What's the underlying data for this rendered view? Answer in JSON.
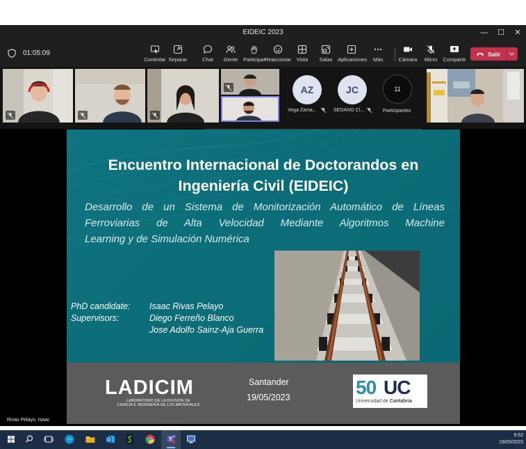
{
  "window": {
    "title": "EIDEIC 2023",
    "controls": {
      "minimize": "—",
      "maximize": "☐",
      "close": "✕"
    }
  },
  "toolbar": {
    "elapsed": "01:05:09",
    "buttons": [
      {
        "name": "controlar",
        "label": "Controlar",
        "icon": "control-icon"
      },
      {
        "name": "separar",
        "label": "Separar",
        "icon": "popout-icon"
      },
      {
        "name": "chat",
        "label": "Chat",
        "icon": "chat-icon"
      },
      {
        "name": "gente",
        "label": "Gente",
        "icon": "people-icon"
      },
      {
        "name": "participar",
        "label": "Participar",
        "icon": "raise-hand-icon"
      },
      {
        "name": "reaccionar",
        "label": "Reaccionar",
        "icon": "emoji-icon"
      },
      {
        "name": "vista",
        "label": "Vista",
        "icon": "grid-view-icon"
      },
      {
        "name": "salas",
        "label": "Salas",
        "icon": "rooms-icon"
      },
      {
        "name": "aplicaciones",
        "label": "Aplicaciones",
        "icon": "plus-icon"
      },
      {
        "name": "mas",
        "label": "Más",
        "icon": "more-icon"
      },
      {
        "name": "camara",
        "label": "Cámara",
        "icon": "camera-icon"
      },
      {
        "name": "micro",
        "label": "Micro",
        "icon": "mic-off-icon"
      },
      {
        "name": "compartir",
        "label": "Compartir",
        "icon": "share-icon"
      }
    ],
    "leave_label": "Salir",
    "leave_color": "#c4314b"
  },
  "participants": {
    "avatars": [
      {
        "initials": "AZ",
        "name": "Vega Zama..."
      },
      {
        "initials": "JC",
        "name": "SEDANO Cl..."
      }
    ],
    "count": "11",
    "count_label": "Participantes"
  },
  "slide": {
    "title_line1": "Encuentro Internacional de Doctorandos en",
    "title_line2": "Ingeniería Civil (EIDEIC)",
    "subtitle_line1": "Desarrollo de un Sistema de Monitorización Automático de Líneas",
    "subtitle_line2": "Ferroviarias de Alta Velocidad Mediante Algoritmos Machine",
    "subtitle_line3": "Learning y de Simulación Numérica",
    "candidate_label": "PhD candidate:",
    "candidate_name": "Isaac Rivas Pelayo",
    "supervisors_label": "Supervisors:",
    "supervisor_1": "Diego Ferreño Blanco",
    "supervisor_2": "Jose Adolfo Sainz-Aja Guerra",
    "ladicim_logo": "LADICIM",
    "ladicim_sub1": "LABORATORIO DE LA DIVISIÓN DE",
    "ladicim_sub2": "CIENCIA E INGENIERÍA DE LOS MATERIALES",
    "place": "Santander",
    "date": "19/05/2023",
    "uc_50": "50",
    "uc_uc": "UC",
    "uc_name_1": "Universidad de ",
    "uc_name_2": "Cantabria",
    "teal": "#0c6f7a"
  },
  "presenter": {
    "name": "Rivas Pelayo, Isaac"
  },
  "taskbar": {
    "time": "9:52",
    "date": "19/05/2023"
  }
}
